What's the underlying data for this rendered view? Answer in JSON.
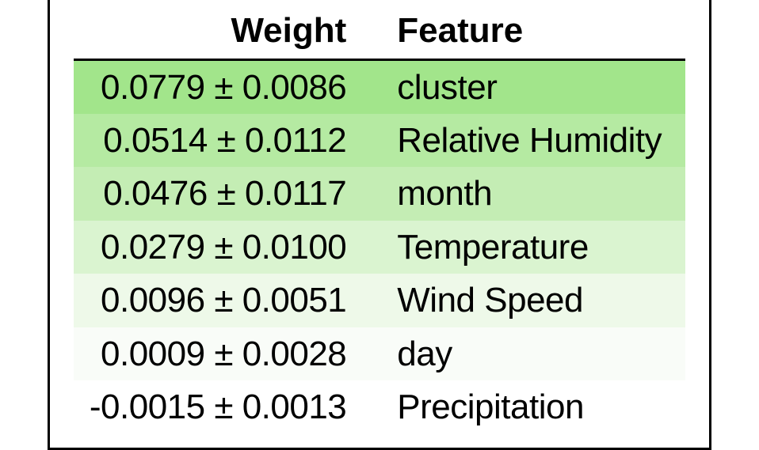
{
  "chart_data": {
    "type": "table",
    "title": "",
    "columns": [
      "Weight",
      "Feature"
    ],
    "rows": [
      {
        "weight": 0.0779,
        "std": 0.0086,
        "weight_str": "0.0779 ± 0.0086",
        "feature": "cluster"
      },
      {
        "weight": 0.0514,
        "std": 0.0112,
        "weight_str": "0.0514 ± 0.0112",
        "feature": "Relative Humidity"
      },
      {
        "weight": 0.0476,
        "std": 0.0117,
        "weight_str": "0.0476 ± 0.0117",
        "feature": "month"
      },
      {
        "weight": 0.0279,
        "std": 0.01,
        "weight_str": "0.0279 ± 0.0100",
        "feature": "Temperature"
      },
      {
        "weight": 0.0096,
        "std": 0.0051,
        "weight_str": "0.0096 ± 0.0051",
        "feature": "Wind Speed"
      },
      {
        "weight": 0.0009,
        "std": 0.0028,
        "weight_str": "0.0009 ± 0.0028",
        "feature": "day"
      },
      {
        "weight": -0.0015,
        "std": 0.0013,
        "weight_str": "-0.0015 ± 0.0013",
        "feature": "Precipitation"
      }
    ]
  }
}
